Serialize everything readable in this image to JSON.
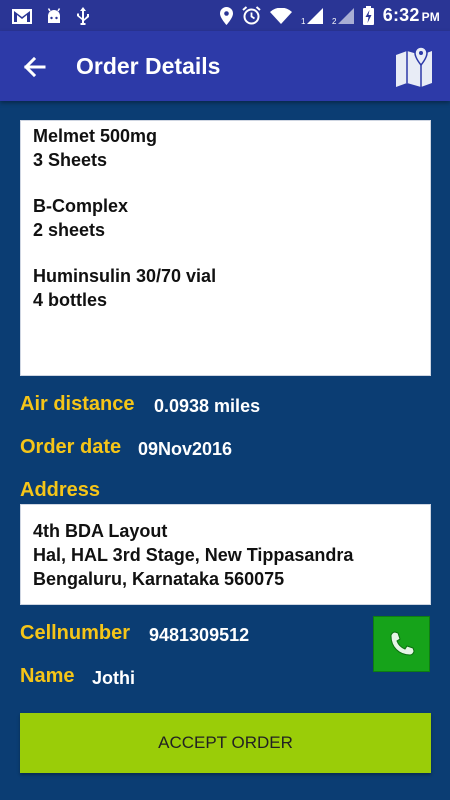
{
  "status_bar": {
    "time": "6:32",
    "ampm": "PM",
    "icons": [
      "gmail-icon",
      "android-icon",
      "usb-icon",
      "location-icon",
      "alarm-icon",
      "wifi-icon",
      "signal-1-icon",
      "signal-2-icon",
      "battery-charging-icon"
    ]
  },
  "app_bar": {
    "title": "Order Details",
    "back_icon": "arrow-left-icon",
    "map_icon": "map-icon"
  },
  "order_items": [
    {
      "name": "Melmet 500mg",
      "quantity": "3 Sheets"
    },
    {
      "name": "B-Complex",
      "quantity": "2 sheets"
    },
    {
      "name": "Huminsulin 30/70 vial",
      "quantity": "4 bottles"
    }
  ],
  "air_distance": {
    "label": "Air distance",
    "value": "0.0938 miles"
  },
  "order_date": {
    "label": "Order date",
    "value": "09Nov2016"
  },
  "address": {
    "label": "Address",
    "lines": [
      "4th BDA Layout",
      "Hal, HAL 3rd Stage, New Tippasandra",
      "Bengaluru, Karnataka 560075"
    ]
  },
  "cellnumber": {
    "label": "Cellnumber",
    "value": "9481309512"
  },
  "name": {
    "label": "Name",
    "value": "Jothi"
  },
  "accept_button": {
    "label": "ACCEPT ORDER"
  },
  "colors": {
    "background": "#0b3d73",
    "app_bar": "#2d3aa8",
    "label": "#f5c518",
    "accept_button": "#9acd08",
    "call_button": "#16a31a"
  }
}
